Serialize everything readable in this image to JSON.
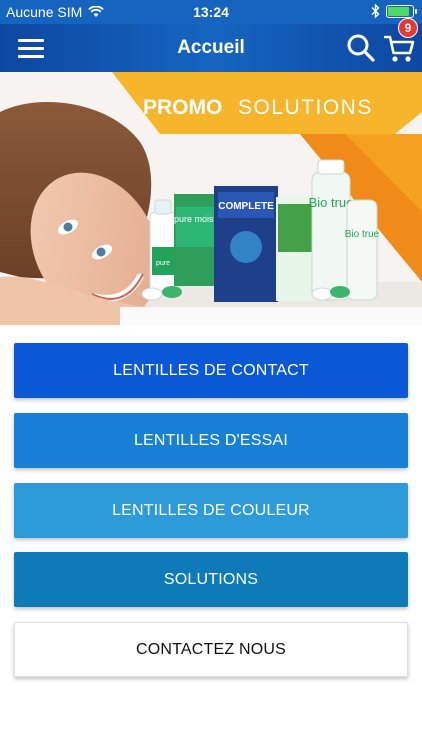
{
  "status_bar": {
    "carrier": "Aucune SIM",
    "time": "13:24"
  },
  "nav": {
    "title": "Accueil",
    "cart_count": "9"
  },
  "banner": {
    "promo_word": "PROMO",
    "solutions_word": "SOLUTIONS",
    "product_labels": [
      "COMPLETE",
      "Bio true",
      "Bio true",
      "pure moist"
    ]
  },
  "menu": {
    "contact_lenses": "LENTILLES DE CONTACT",
    "trial_lenses": "LENTILLES D'ESSAI",
    "color_lenses": "LENTILLES DE COULEUR",
    "solutions": "SOLUTIONS",
    "contact_us": "CONTACTEZ NOUS"
  },
  "colors": {
    "nav_blue": "#1565c0",
    "btn_contact": "#0a58d6",
    "btn_essai": "#1780d6",
    "btn_couleur": "#2d9bd9",
    "btn_solutions": "#0e7ab8",
    "promo_yellow": "#f7b52c",
    "badge_red": "#e53935"
  }
}
